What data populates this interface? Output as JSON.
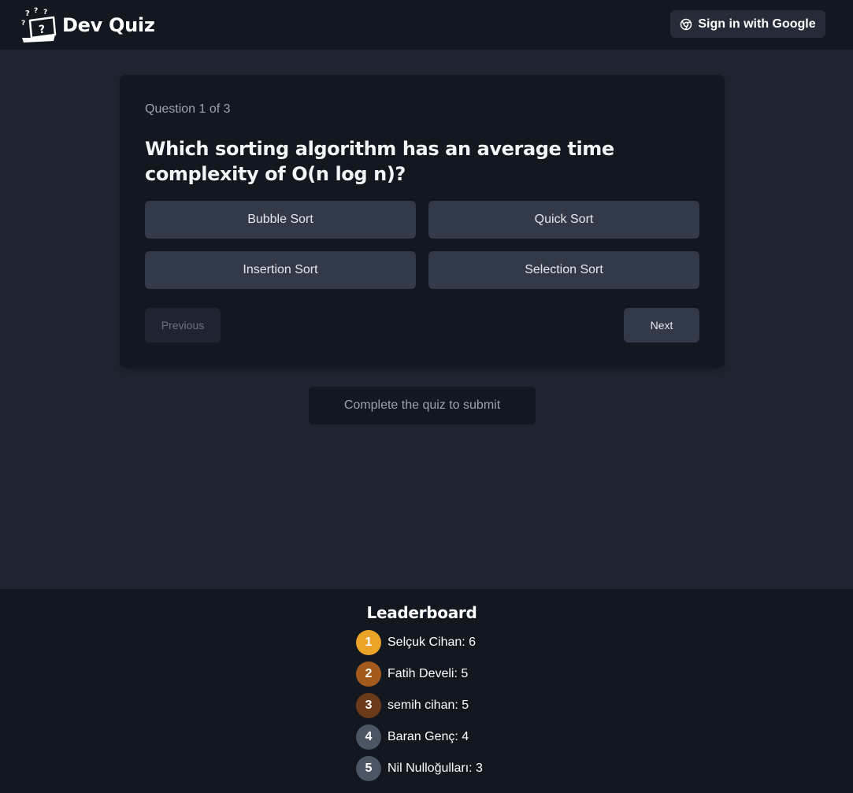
{
  "app": {
    "title": "Dev Quiz"
  },
  "header": {
    "signin_label": "Sign in with Google",
    "signin_icon": "chrome-icon"
  },
  "quiz": {
    "counter": "Question 1 of 3",
    "question": "Which sorting algorithm has an average time complexity of O(n log n)?",
    "options": [
      "Bubble Sort",
      "Quick Sort",
      "Insertion Sort",
      "Selection Sort"
    ],
    "previous_label": "Previous",
    "next_label": "Next",
    "submit_label": "Complete the quiz to submit"
  },
  "leaderboard": {
    "title": "Leaderboard",
    "entries": [
      {
        "rank": "1",
        "text": "Selçuk Cihan: 6",
        "color": "#eca32a"
      },
      {
        "rank": "2",
        "text": "Fatih Develi: 5",
        "color": "#a15a1c"
      },
      {
        "rank": "3",
        "text": "semih cihan: 5",
        "color": "#6b3a1a"
      },
      {
        "rank": "4",
        "text": "Baran Genç: 4",
        "color": "#4b5563"
      },
      {
        "rank": "5",
        "text": "Nil Nulloğulları: 3",
        "color": "#4b5563"
      }
    ]
  },
  "colors": {
    "background": "#1f2430",
    "panel": "#121720",
    "option": "#323a49"
  }
}
